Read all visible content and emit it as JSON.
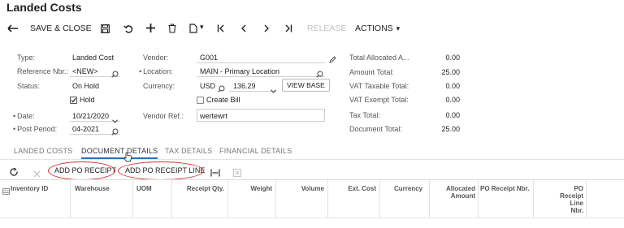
{
  "page": {
    "title": "Landed Costs"
  },
  "toolbar": {
    "save_close": "SAVE & CLOSE",
    "release": "RELEASE",
    "actions": "ACTIONS",
    "actions_caret": "▾",
    "copy_caret": "▾"
  },
  "form": {
    "type_label": "Type:",
    "type_value": "Landed Cost",
    "refnbr_label": "Reference Nbr.:",
    "refnbr_value": "<NEW>",
    "status_label": "Status:",
    "status_value": "On Hold",
    "hold_label": "Hold",
    "date_label": "Date:",
    "date_value": "10/21/2020",
    "postperiod_label": "Post Period:",
    "postperiod_value": "04-2021",
    "vendor_label": "Vendor:",
    "vendor_value": "G001",
    "location_label": "Location:",
    "location_value": "MAIN - Primary Location",
    "currency_label": "Currency:",
    "currency_code": "USD",
    "currency_rate": "136.29",
    "view_base": "VIEW BASE",
    "create_bill_label": "Create Bill",
    "vendorref_label": "Vendor Ref.:",
    "vendorref_value": "wertewrt",
    "total_allocated_label": "Total Allocated A...",
    "total_allocated_value": "0.00",
    "amount_total_label": "Amount Total:",
    "amount_total_value": "25.00",
    "vat_taxable_label": "VAT Taxable Total:",
    "vat_taxable_value": "0.00",
    "vat_exempt_label": "VAT Exempt Total:",
    "vat_exempt_value": "0.00",
    "tax_total_label": "Tax Total:",
    "tax_total_value": "0.00",
    "doc_total_label": "Document Total:",
    "doc_total_value": "25.00"
  },
  "tabs": [
    "LANDED COSTS",
    "DOCUMENT DETAILS",
    "TAX DETAILS",
    "FINANCIAL DETAILS"
  ],
  "grid_toolbar": {
    "add_po_receipt": "ADD PO RECEIPT",
    "add_po_receipt_line": "ADD PO RECEIPT LINE"
  },
  "grid": {
    "columns": {
      "inventory_id": "Inventory ID",
      "warehouse": "Warehouse",
      "uom": "UOM",
      "receipt_qty": "Receipt Qty.",
      "weight": "Weight",
      "volume": "Volume",
      "ext_cost": "Ext. Cost",
      "currency": "Currency",
      "allocated_amount_1": "Allocated",
      "allocated_amount_2": "Amount",
      "po_receipt_nbr": "PO Receipt Nbr.",
      "po_line_1": "PO",
      "po_line_2": "Receipt",
      "po_line_3": "Line",
      "po_line_4": "Nbr."
    }
  },
  "colors": {
    "accent": "#2b6cc4",
    "highlight": "#d32f2f"
  }
}
